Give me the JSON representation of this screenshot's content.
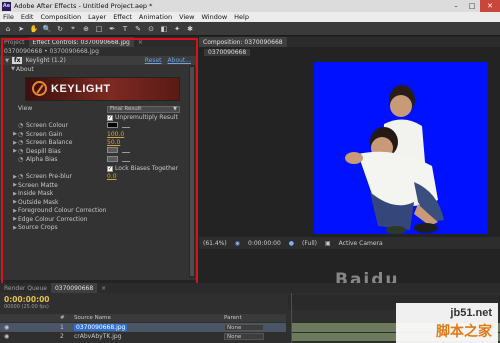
{
  "window": {
    "app_icon": "Ae",
    "title": "Adobe After Effects - Untitled Project.aep *",
    "controls": [
      "–",
      "□",
      "✕"
    ]
  },
  "menu": [
    "File",
    "Edit",
    "Composition",
    "Layer",
    "Effect",
    "Animation",
    "View",
    "Window",
    "Help"
  ],
  "toolbar": {
    "icons": [
      "home-icon",
      "selection-tool-icon",
      "hand-tool-icon",
      "zoom-tool-icon",
      "rotate-tool-icon",
      "camera-tool-icon",
      "pan-behind-icon",
      "rectangle-tool-icon",
      "pen-tool-icon",
      "text-tool-icon",
      "brush-tool-icon",
      "clone-stamp-icon",
      "eraser-icon",
      "roto-brush-icon",
      "puppet-tool-icon"
    ],
    "glyphs": [
      "⌂",
      "➤",
      "✋",
      "🔍",
      "↻",
      "⌖",
      "⊕",
      "□",
      "✒",
      "T",
      "✎",
      "⊙",
      "◧",
      "✦",
      "✱"
    ]
  },
  "left_tabs": [
    "Project",
    "Effect Controls: 0370090668.jpg",
    "×"
  ],
  "effect_controls": {
    "header": "0370090668 • 0370090668.jpg",
    "effect_name": "Keylight (1.2)",
    "reset": "Reset",
    "about": "About...",
    "about_group": "About",
    "logo_text": "KEYLIGHT",
    "view_label": "View",
    "view_value": "Final Result",
    "unpremultiply": "Unpremultiply Result",
    "params": [
      {
        "label": "Screen Colour",
        "type": "color"
      },
      {
        "label": "Screen Gain",
        "value": "100.0"
      },
      {
        "label": "Screen Balance",
        "value": "50.0"
      },
      {
        "label": "Despill Bias",
        "type": "color"
      },
      {
        "label": "Alpha Bias",
        "type": "color"
      }
    ],
    "lock_biases": "Lock Biases Together",
    "screen_preblur": {
      "label": "Screen Pre-blur",
      "value": "0.0"
    },
    "sections": [
      "Screen Matte",
      "Inside Mask",
      "Outside Mask",
      "Foreground Colour Correction",
      "Edge Colour Correction",
      "Source Crops"
    ]
  },
  "comp": {
    "tab": "Composition: 0370090668",
    "label": "0370090668",
    "controls": {
      "zoom": "(61.4%)",
      "timecode": "0:00:00:00",
      "resolution": "(Full)",
      "camera": "Active Camera"
    }
  },
  "timeline": {
    "tabs": [
      "Render Queue",
      "0370090668",
      "×"
    ],
    "time": "0:00:00:00",
    "fps": "00000 (25.00 fps)",
    "col_num": "#",
    "col_name": "Source Name",
    "col_parent": "Parent",
    "layers": [
      {
        "num": "1",
        "name": "0370090668.jpg",
        "parent": "None",
        "selected": true
      },
      {
        "num": "2",
        "name": "crAbvAbyTK.jpg",
        "parent": "None",
        "selected": false
      }
    ]
  },
  "watermarks": {
    "url": "jb51.net",
    "cn": "脚本之家",
    "baidu": "Baidu"
  }
}
